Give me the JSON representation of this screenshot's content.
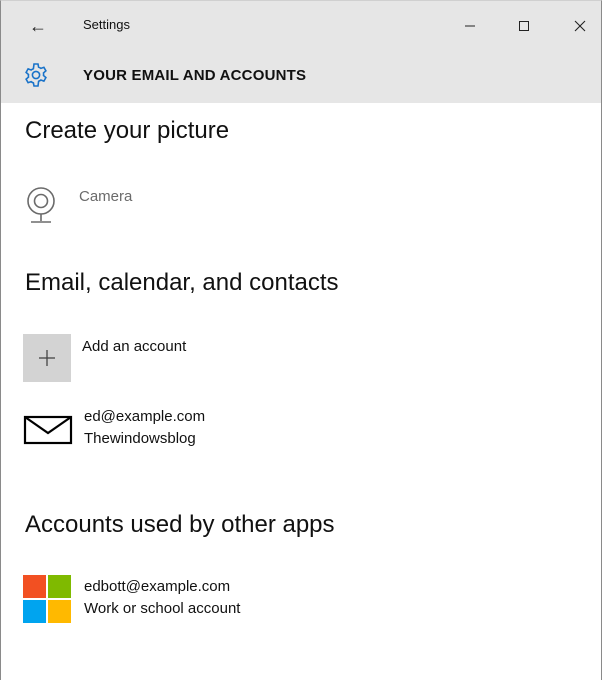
{
  "window": {
    "title": "Settings",
    "back_icon": "←",
    "minimize_icon": "minimize-icon",
    "maximize_icon": "maximize-icon",
    "close_icon": "close-icon"
  },
  "header": {
    "title": "YOUR EMAIL AND ACCOUNTS",
    "icon": "gear-icon",
    "accent": "#1a73c9"
  },
  "sections": {
    "picture": {
      "title": "Create your picture",
      "items": [
        {
          "label": "Camera",
          "icon": "camera-icon"
        }
      ]
    },
    "email": {
      "title": "Email, calendar, and contacts",
      "add_account_label": "Add an account",
      "accounts": [
        {
          "email": "ed@example.com",
          "name": "Thewindowsblog",
          "icon": "mail-icon"
        }
      ]
    },
    "other_apps": {
      "title": "Accounts used by other apps",
      "accounts": [
        {
          "email": "edbott@example.com",
          "type": "Work or school account",
          "icon": "microsoft-logo-icon"
        }
      ]
    }
  },
  "colors": {
    "header_bg": "#e6e6e6",
    "ms_red": "#f25022",
    "ms_green": "#7fba00",
    "ms_blue": "#00a4ef",
    "ms_yellow": "#ffb900"
  }
}
